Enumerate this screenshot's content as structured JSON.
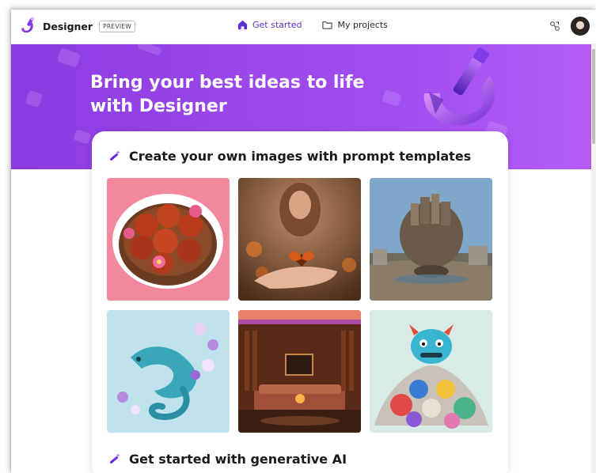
{
  "header": {
    "brand_name": "Designer",
    "preview_badge": "PREVIEW",
    "nav": [
      {
        "label": "Get started",
        "icon": "home-icon",
        "active": true
      },
      {
        "label": "My projects",
        "icon": "folder-icon",
        "active": false
      }
    ],
    "accent_color": "#5b2fd1"
  },
  "hero": {
    "title": "Bring your best ideas to life with Designer",
    "gradient_start": "#8a3ce0",
    "gradient_end": "#b45cf4"
  },
  "prompt_templates": {
    "heading": "Create your own images with prompt templates",
    "tiles": [
      {
        "name": "sweets-bowl-sticker"
      },
      {
        "name": "butterfly-on-hand"
      },
      {
        "name": "floating-city-rock"
      },
      {
        "name": "paper-iguana-flowers"
      },
      {
        "name": "cozy-living-room"
      },
      {
        "name": "monster-on-clothes-pile"
      }
    ]
  },
  "generative_ai": {
    "heading": "Get started with generative AI"
  }
}
